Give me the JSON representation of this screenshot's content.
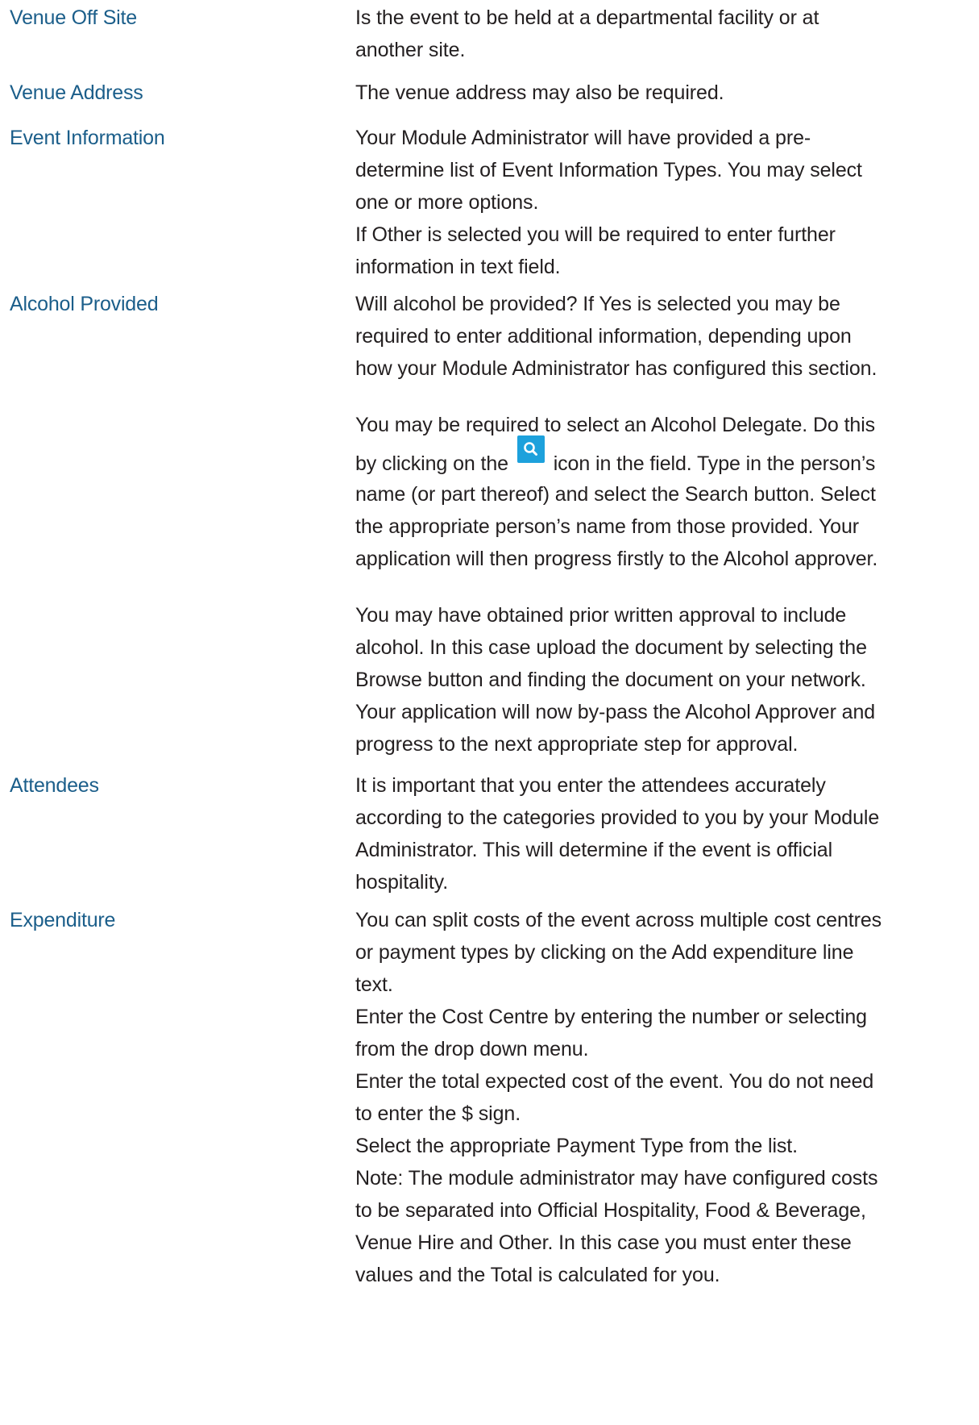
{
  "rows": [
    {
      "term": "Venue Off Site",
      "lines": [
        "Is the event to be held at a departmental facility or at",
        "another site."
      ]
    },
    {
      "term": "Venue Address",
      "lines": [
        "The venue address may also be required."
      ]
    },
    {
      "term": "Event Information",
      "lines": [
        "Your Module Administrator will have provided a pre-",
        "determine list of Event Information Types. You may select",
        "one or more options.",
        "If Other is selected you will be required to enter further",
        "information in text field."
      ]
    },
    {
      "term": "Alcohol Provided",
      "para1": [
        "Will alcohol be provided? If Yes is selected you may be",
        "required to enter additional information, depending upon",
        "how your Module Administrator has configured this section."
      ],
      "para2_line1": "You may be required to select an Alcohol Delegate. Do this",
      "para2_icon_before": "by clicking on the",
      "para2_icon_after": "icon in the field. Type in the person’s",
      "para2_icon": "search-icon",
      "para2_rest": [
        "name (or part thereof) and select the Search button. Select",
        "the appropriate person’s name from those provided. Your",
        "application will then progress firstly to the Alcohol approver."
      ],
      "para3": [
        "You may have obtained prior written approval to include",
        "alcohol. In this case upload the document by selecting the",
        "Browse button and finding the document on your network.",
        "Your application will now by-pass the Alcohol Approver and",
        "progress to the next appropriate step for approval."
      ]
    },
    {
      "term": "Attendees",
      "lines": [
        "It is important that you enter the attendees accurately",
        "according to the categories provided to you by your Module",
        "Administrator. This will determine if the event is official",
        "hospitality."
      ]
    },
    {
      "term": "Expenditure",
      "lines": [
        "You can split costs of the event across multiple cost centres",
        "or payment types by clicking on the Add expenditure line",
        "text.",
        "Enter the Cost Centre by entering the number or selecting",
        "from the drop down menu.",
        "Enter the total expected cost of the event. You do not need",
        "to enter the $ sign.",
        "Select the appropriate Payment Type from the list.",
        "Note: The module administrator may have configured costs",
        "to be separated into Official Hospitality, Food & Beverage,",
        "Venue Hire and Other. In this case you must enter these",
        "values and the Total is calculated for you."
      ]
    }
  ],
  "colors": {
    "term": "#1b5e8a",
    "text": "#231f20",
    "icon_bg": "#1da1dc"
  }
}
